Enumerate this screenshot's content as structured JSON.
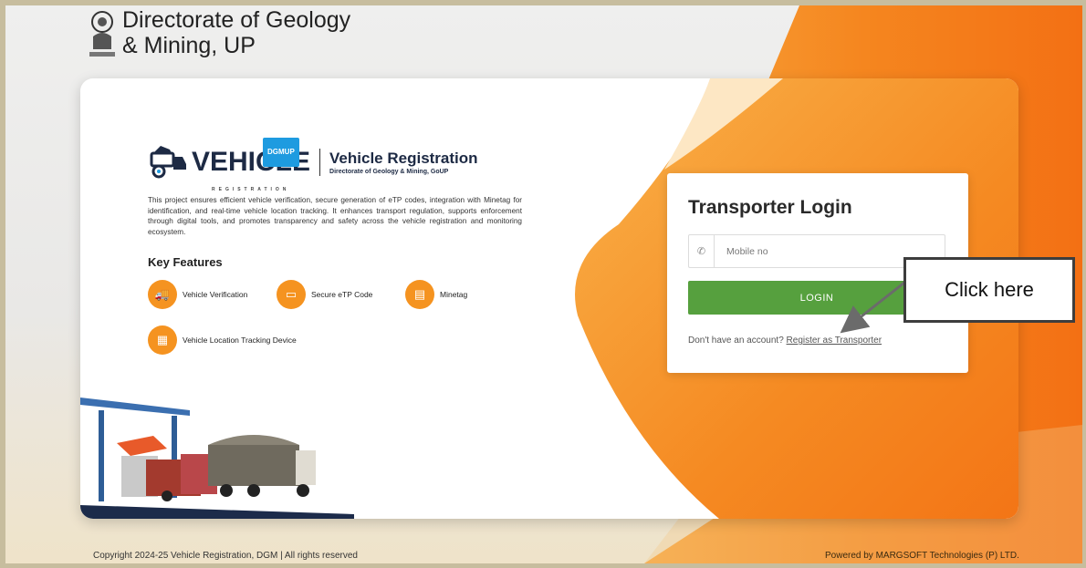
{
  "header": {
    "org_line1": "Directorate of Geology",
    "org_line2": "& Mining, UP",
    "emblem_icon": "up-state-emblem-icon"
  },
  "brand": {
    "tag": "DGMUP",
    "logo_word": "VEHICLE",
    "logo_sub": "REGISTRATION",
    "title": "Vehicle Registration",
    "subtitle": "Directorate of Geology & Mining, GoUP"
  },
  "description": "This project ensures efficient vehicle verification, secure generation of eTP codes, integration with Minetag for identification, and real-time vehicle location tracking. It enhances transport regulation, supports enforcement through digital tools, and promotes transparency and safety across the vehicle registration and monitoring ecosystem.",
  "key_features": {
    "heading": "Key Features",
    "items": [
      {
        "label": "Vehicle Verification",
        "icon": "truck-check-icon"
      },
      {
        "label": "Secure eTP Code",
        "icon": "code-card-icon"
      },
      {
        "label": "Minetag",
        "icon": "tag-icon"
      },
      {
        "label": "Vehicle Location Tracking Device",
        "icon": "tracking-device-icon"
      }
    ]
  },
  "login": {
    "title": "Transporter Login",
    "mobile_placeholder": "Mobile no",
    "mobile_value": "",
    "phone_icon": "phone-icon",
    "button_label": "LOGIN",
    "no_account_text": "Don't have an account?",
    "register_link": "Register as Transporter"
  },
  "callout": {
    "text": "Click here"
  },
  "footer": {
    "copyright": "Copyright 2024-25 Vehicle Registration, DGM | All rights reserved",
    "powered_by": "Powered by MARGSOFT Technologies (P) LTD."
  },
  "colors": {
    "accent_orange": "#f58220",
    "login_green": "#56a03e",
    "brand_navy": "#1d2a44",
    "tag_blue": "#1e9be0"
  }
}
